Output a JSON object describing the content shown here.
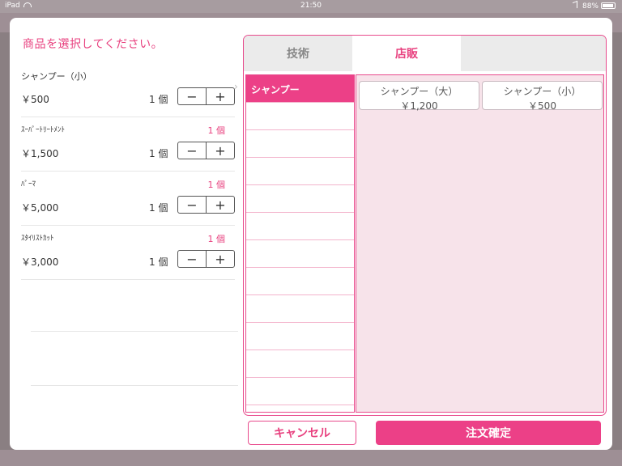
{
  "statusbar": {
    "device": "iPad",
    "time": "21:50",
    "battery": "88%"
  },
  "left": {
    "title": "商品を選択してください。",
    "items": [
      {
        "name": "シャンプー（小）",
        "badge": "",
        "price": "￥500",
        "qty": "1 個"
      },
      {
        "name": "ｽｰﾊﾟｰﾄﾘｰﾄﾒﾝﾄ",
        "badge": "1 個",
        "price": "￥1,500",
        "qty": "1 個"
      },
      {
        "name": "ﾊﾟｰﾏ",
        "badge": "1 個",
        "price": "￥5,000",
        "qty": "1 個"
      },
      {
        "name": "ｽﾀｲﾘｽﾄｶｯﾄ",
        "badge": "1 個",
        "price": "￥3,000",
        "qty": "1 個"
      }
    ],
    "minus": "−",
    "plus": "+",
    "chevron": "›"
  },
  "tabs": [
    "技術",
    "店販"
  ],
  "categories": [
    "シャンプー"
  ],
  "products": [
    {
      "name": "シャンプー（大）",
      "price": "￥1,200"
    },
    {
      "name": "シャンプー（小）",
      "price": "￥500"
    }
  ],
  "footer": {
    "cancel": "キャンセル",
    "confirm": "注文確定"
  },
  "colors": {
    "accent": "#ec4087",
    "accent_text": "#e8417f",
    "product_area_bg": "#f7e3ea"
  }
}
